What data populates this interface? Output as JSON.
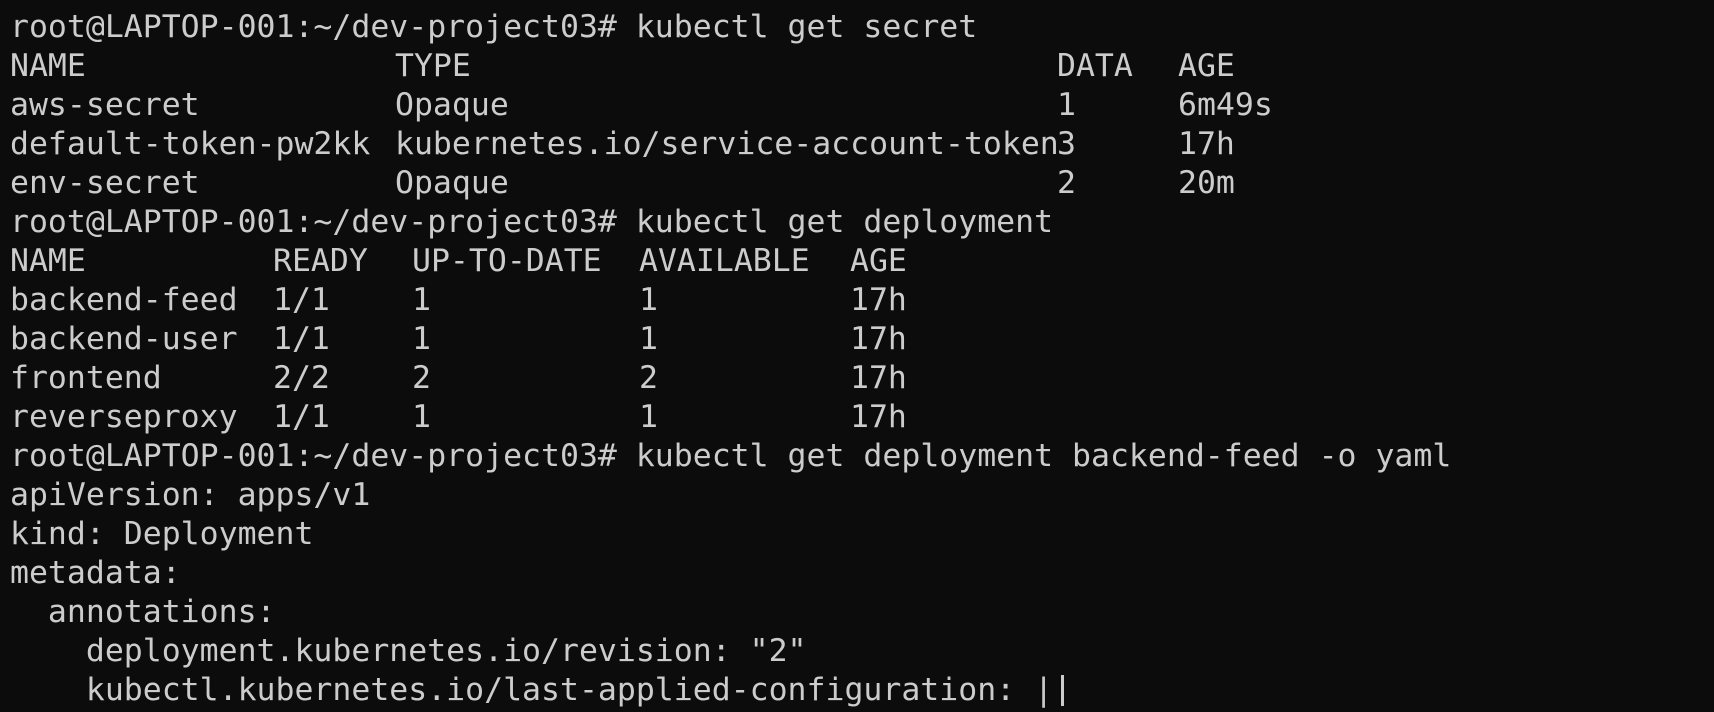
{
  "terminal": {
    "prompt": "root@LAPTOP-001:~/dev-project03#",
    "commands": [
      "kubectl get secret",
      "kubectl get deployment",
      "kubectl get deployment backend-feed -o yaml"
    ]
  },
  "secrets": {
    "headers": [
      "NAME",
      "TYPE",
      "DATA",
      "AGE"
    ],
    "rows": [
      [
        "aws-secret",
        "Opaque",
        "1",
        "6m49s"
      ],
      [
        "default-token-pw2kk",
        "kubernetes.io/service-account-token",
        "3",
        "17h"
      ],
      [
        "env-secret",
        "Opaque",
        "2",
        "20m"
      ]
    ]
  },
  "deployments": {
    "headers": [
      "NAME",
      "READY",
      "UP-TO-DATE",
      "AVAILABLE",
      "AGE"
    ],
    "rows": [
      [
        "backend-feed",
        "1/1",
        "1",
        "1",
        "17h"
      ],
      [
        "backend-user",
        "1/1",
        "1",
        "1",
        "17h"
      ],
      [
        "frontend",
        "2/2",
        "2",
        "2",
        "17h"
      ],
      [
        "reverseproxy",
        "1/1",
        "1",
        "1",
        "17h"
      ]
    ]
  },
  "yaml": [
    "apiVersion: apps/v1",
    "kind: Deployment",
    "metadata:",
    "  annotations:",
    "    deployment.kubernetes.io/revision: \"2\"",
    "    kubectl.kubernetes.io/last-applied-configuration: |"
  ]
}
